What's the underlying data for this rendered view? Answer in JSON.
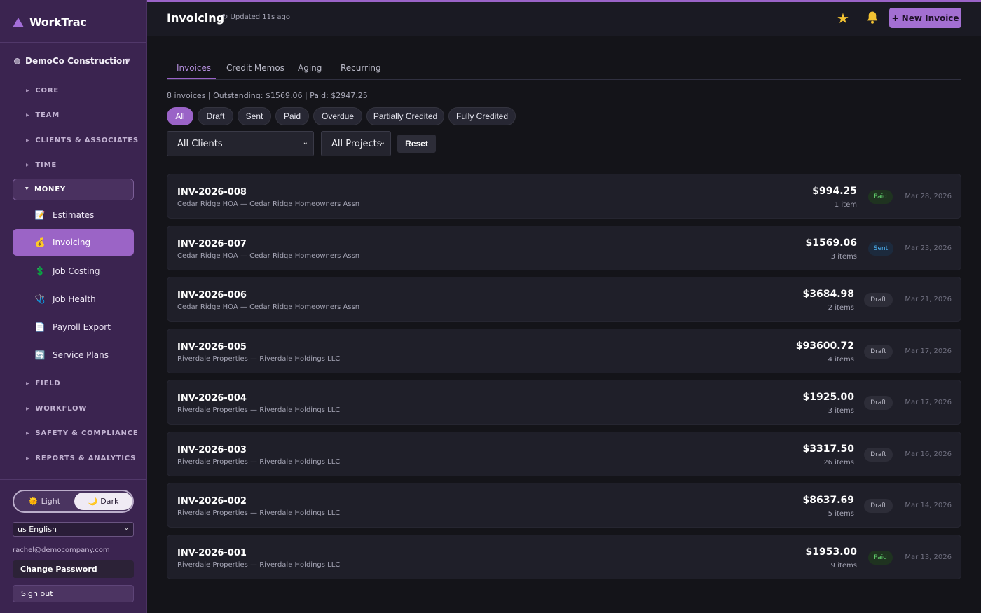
{
  "app": {
    "name": "WorkTrac"
  },
  "sidebar": {
    "org": "DemoCo Construction",
    "sections": [
      "CORE",
      "TEAM",
      "CLIENTS & ASSOCIATES",
      "TIME"
    ],
    "money_label": "MONEY",
    "money_items": [
      {
        "label": "Estimates",
        "icon": "📝"
      },
      {
        "label": "Invoicing",
        "icon": "💰"
      },
      {
        "label": "Job Costing",
        "icon": "💲"
      },
      {
        "label": "Job Health",
        "icon": "🩺"
      },
      {
        "label": "Payroll Export",
        "icon": "📄"
      },
      {
        "label": "Service Plans",
        "icon": "🔄"
      }
    ],
    "active_item": "Invoicing",
    "sections_after": [
      "FIELD",
      "WORKFLOW",
      "SAFETY & COMPLIANCE",
      "REPORTS & ANALYTICS"
    ],
    "theme": {
      "light": "Light",
      "dark": "Dark",
      "selected": "Dark"
    },
    "language": "us English",
    "email": "rachel@democompany.com",
    "change_password": "Change Password",
    "sign_out": "Sign out"
  },
  "header": {
    "title": "Invoicing",
    "updated": "↻ Updated 11s ago",
    "new_invoice": "+ New Invoice"
  },
  "tabs": [
    "Invoices",
    "Credit Memos",
    "Aging",
    "Recurring"
  ],
  "active_tab": "Invoices",
  "summary": "8 invoices | Outstanding: $1569.06 | Paid: $2947.25",
  "filters": {
    "chips": [
      "All",
      "Draft",
      "Sent",
      "Paid",
      "Overdue",
      "Partially Credited",
      "Fully Credited"
    ],
    "active_chip": "All",
    "client_select": "All Clients",
    "project_select": "All Projects",
    "reset": "Reset"
  },
  "invoices": [
    {
      "number": "INV-2026-008",
      "client": "Cedar Ridge HOA — Cedar Ridge Homeowners Assn",
      "amount": "$994.25",
      "items": "1 item",
      "status": "Paid",
      "date": "Mar 28, 2026"
    },
    {
      "number": "INV-2026-007",
      "client": "Cedar Ridge HOA — Cedar Ridge Homeowners Assn",
      "amount": "$1569.06",
      "items": "3 items",
      "status": "Sent",
      "date": "Mar 23, 2026"
    },
    {
      "number": "INV-2026-006",
      "client": "Cedar Ridge HOA — Cedar Ridge Homeowners Assn",
      "amount": "$3684.98",
      "items": "2 items",
      "status": "Draft",
      "date": "Mar 21, 2026"
    },
    {
      "number": "INV-2026-005",
      "client": "Riverdale Properties — Riverdale Holdings LLC",
      "amount": "$93600.72",
      "items": "4 items",
      "status": "Draft",
      "date": "Mar 17, 2026"
    },
    {
      "number": "INV-2026-004",
      "client": "Riverdale Properties — Riverdale Holdings LLC",
      "amount": "$1925.00",
      "items": "3 items",
      "status": "Draft",
      "date": "Mar 17, 2026"
    },
    {
      "number": "INV-2026-003",
      "client": "Riverdale Properties — Riverdale Holdings LLC",
      "amount": "$3317.50",
      "items": "26 items",
      "status": "Draft",
      "date": "Mar 16, 2026"
    },
    {
      "number": "INV-2026-002",
      "client": "Riverdale Properties — Riverdale Holdings LLC",
      "amount": "$8637.69",
      "items": "5 items",
      "status": "Draft",
      "date": "Mar 14, 2026"
    },
    {
      "number": "INV-2026-001",
      "client": "Riverdale Properties — Riverdale Holdings LLC",
      "amount": "$1953.00",
      "items": "9 items",
      "status": "Paid",
      "date": "Mar 13, 2026"
    }
  ],
  "colors": {
    "accent": "#9a63c7",
    "sidebar": "#3b2450",
    "paid": "#63d36e",
    "sent": "#4db2f2"
  }
}
